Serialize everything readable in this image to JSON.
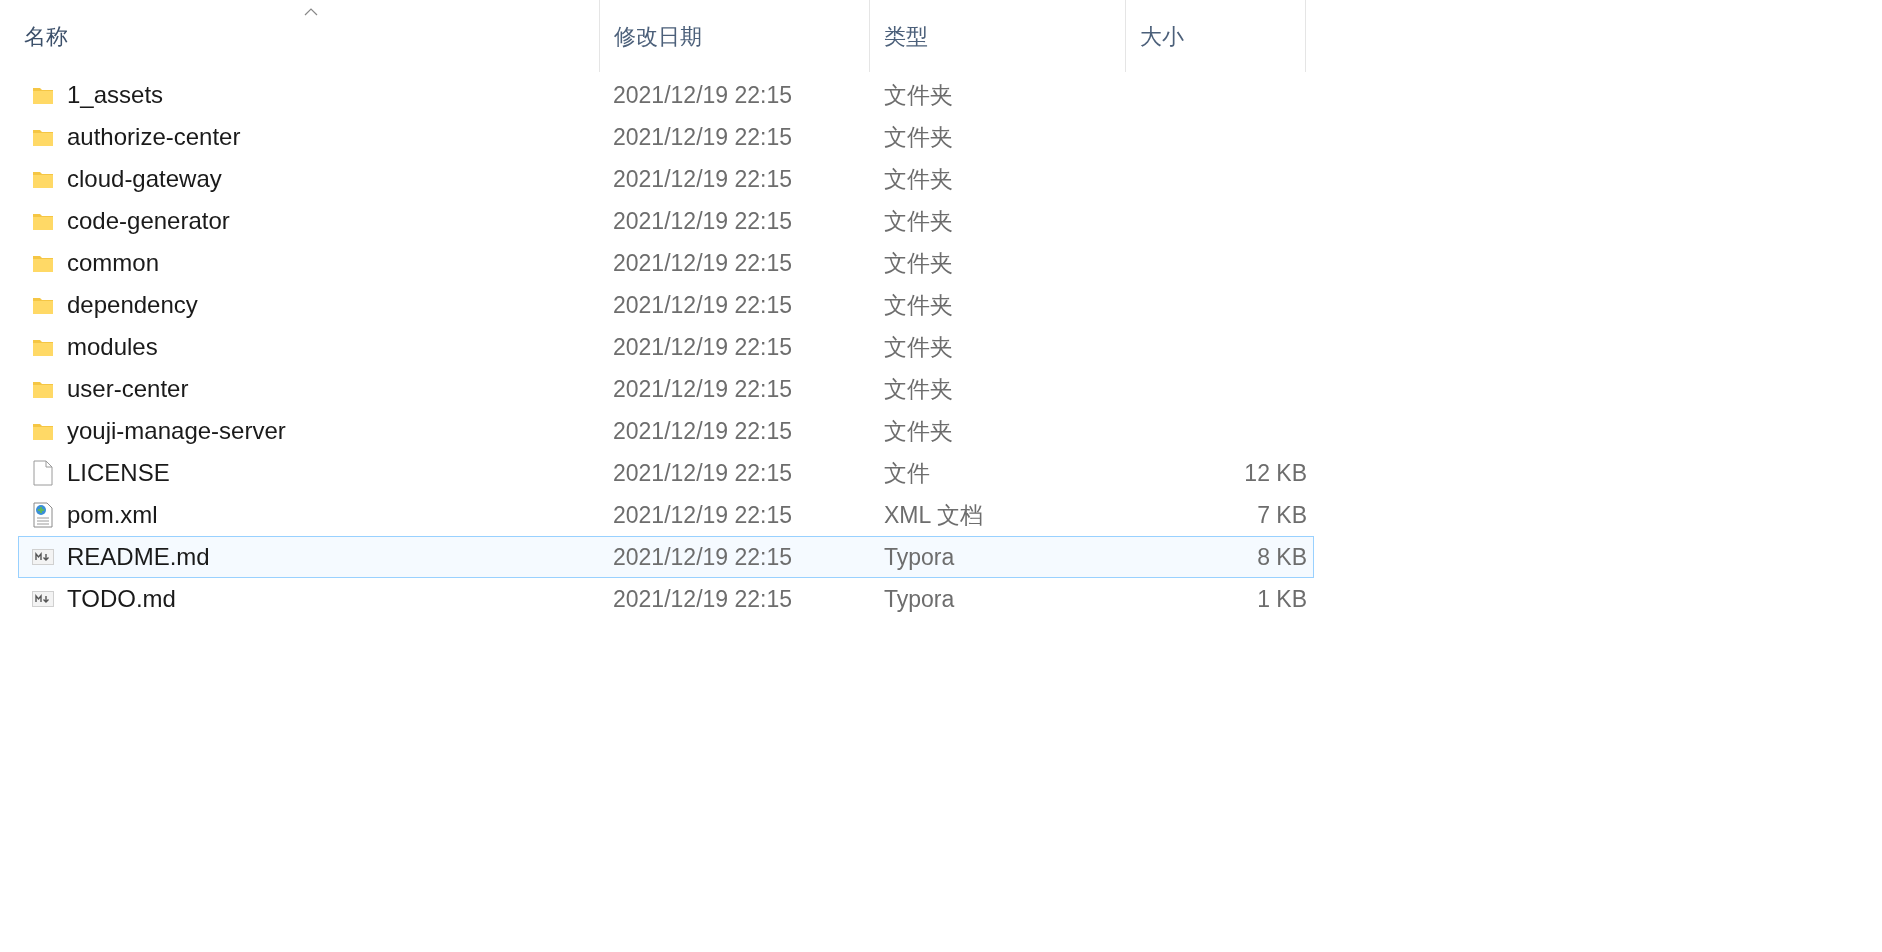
{
  "columns": [
    {
      "label": "名称",
      "sorted": true
    },
    {
      "label": "修改日期",
      "sorted": false
    },
    {
      "label": "类型",
      "sorted": false
    },
    {
      "label": "大小",
      "sorted": false
    }
  ],
  "rows": [
    {
      "kind": "folder",
      "name": "1_assets",
      "date": "2021/12/19 22:15",
      "type": "文件夹",
      "selected": false
    },
    {
      "kind": "folder",
      "name": "authorize-center",
      "date": "2021/12/19 22:15",
      "type": "文件夹",
      "selected": false
    },
    {
      "kind": "folder",
      "name": "cloud-gateway",
      "date": "2021/12/19 22:15",
      "type": "文件夹",
      "selected": false
    },
    {
      "kind": "folder",
      "name": "code-generator",
      "date": "2021/12/19 22:15",
      "type": "文件夹",
      "selected": false
    },
    {
      "kind": "folder",
      "name": "common",
      "date": "2021/12/19 22:15",
      "type": "文件夹",
      "selected": false
    },
    {
      "kind": "folder",
      "name": "dependency",
      "date": "2021/12/19 22:15",
      "type": "文件夹",
      "selected": false
    },
    {
      "kind": "folder",
      "name": "modules",
      "date": "2021/12/19 22:15",
      "type": "文件夹",
      "selected": false
    },
    {
      "kind": "folder",
      "name": "user-center",
      "date": "2021/12/19 22:15",
      "type": "文件夹",
      "selected": false
    },
    {
      "kind": "folder",
      "name": "youji-manage-server",
      "date": "2021/12/19 22:15",
      "type": "文件夹",
      "selected": false
    },
    {
      "kind": "file",
      "name": "LICENSE",
      "date": "2021/12/19 22:15",
      "type": "文件",
      "size": "12 KB",
      "selected": false
    },
    {
      "kind": "xml",
      "name": "pom.xml",
      "date": "2021/12/19 22:15",
      "type": "XML 文档",
      "size": "7 KB",
      "selected": false
    },
    {
      "kind": "markdown",
      "name": "README.md",
      "date": "2021/12/19 22:15",
      "type": "Typora",
      "size": "8 KB",
      "selected": true
    },
    {
      "kind": "markdown",
      "name": "TODO.md",
      "date": "2021/12/19 22:15",
      "type": "Typora",
      "size": "1 KB",
      "selected": false
    }
  ]
}
